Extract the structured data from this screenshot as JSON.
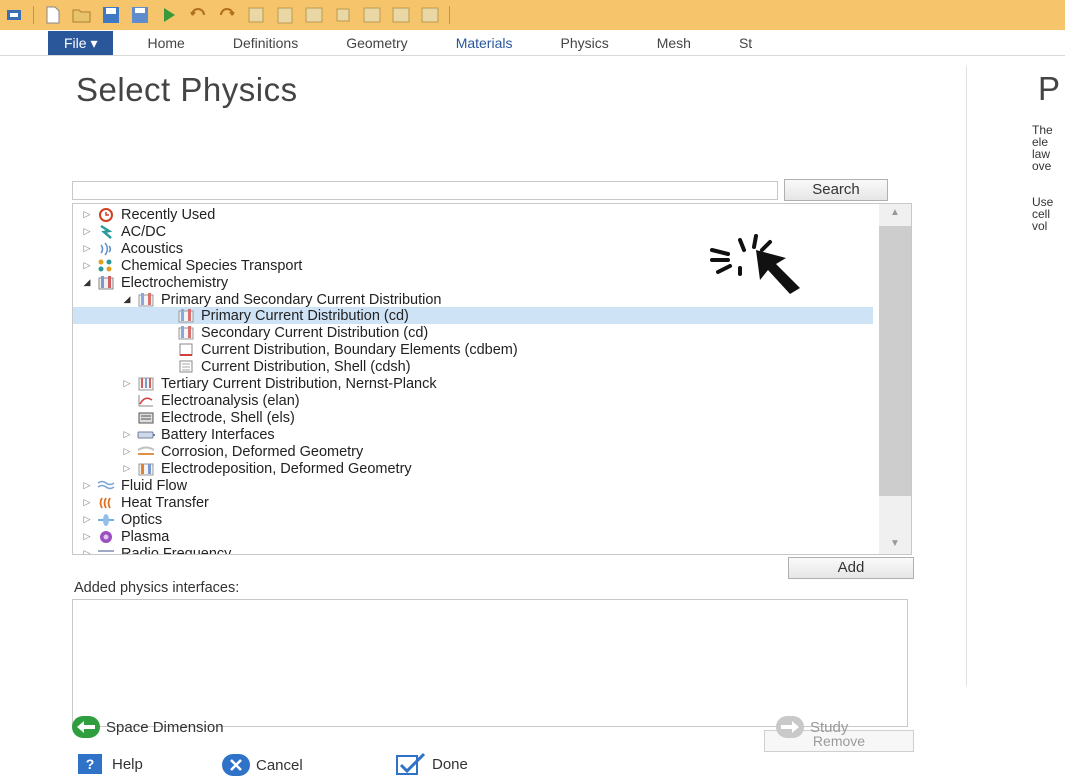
{
  "ribbon": {
    "tabs": [
      "File ▾",
      "Home",
      "Definitions",
      "Geometry",
      "Materials",
      "Physics",
      "Mesh",
      "St"
    ]
  },
  "panel": {
    "title": "Select Physics",
    "search": {
      "value": "",
      "button_label": "Search"
    },
    "tree": [
      {
        "label": "Recently Used",
        "level": 0,
        "expand": "collapsed",
        "icon": "clock-icon"
      },
      {
        "label": "AC/DC",
        "level": 0,
        "expand": "collapsed",
        "icon": "acdc-icon"
      },
      {
        "label": "Acoustics",
        "level": 0,
        "expand": "collapsed",
        "icon": "acoustics-icon"
      },
      {
        "label": "Chemical Species Transport",
        "level": 0,
        "expand": "collapsed",
        "icon": "species-icon"
      },
      {
        "label": "Electrochemistry",
        "level": 0,
        "expand": "expanded",
        "icon": "electrochemistry-icon"
      },
      {
        "label": "Primary and Secondary Current Distribution",
        "level": 1,
        "expand": "expanded",
        "icon": "current-distribution-icon"
      },
      {
        "label": "Primary Current Distribution (cd)",
        "level": 2,
        "expand": "none",
        "icon": "current-distribution-icon",
        "selected": true
      },
      {
        "label": "Secondary Current Distribution (cd)",
        "level": 2,
        "expand": "none",
        "icon": "current-distribution-icon"
      },
      {
        "label": "Current Distribution, Boundary Elements (cdbem)",
        "level": 2,
        "expand": "none",
        "icon": "boundary-elements-icon"
      },
      {
        "label": "Current Distribution, Shell (cdsh)",
        "level": 2,
        "expand": "none",
        "icon": "shell-icon"
      },
      {
        "label": "Tertiary Current Distribution, Nernst-Planck",
        "level": 1,
        "expand": "collapsed",
        "icon": "tertiary-icon"
      },
      {
        "label": "Electroanalysis (elan)",
        "level": 1,
        "expand": "none",
        "icon": "electroanalysis-icon"
      },
      {
        "label": "Electrode, Shell (els)",
        "level": 1,
        "expand": "none",
        "icon": "electrode-shell-icon"
      },
      {
        "label": "Battery Interfaces",
        "level": 1,
        "expand": "collapsed",
        "icon": "battery-icon"
      },
      {
        "label": "Corrosion, Deformed Geometry",
        "level": 1,
        "expand": "collapsed",
        "icon": "corrosion-icon"
      },
      {
        "label": "Electrodeposition, Deformed Geometry",
        "level": 1,
        "expand": "collapsed",
        "icon": "electrodeposition-icon"
      },
      {
        "label": "Fluid Flow",
        "level": 0,
        "expand": "collapsed",
        "icon": "fluid-flow-icon"
      },
      {
        "label": "Heat Transfer",
        "level": 0,
        "expand": "collapsed",
        "icon": "heat-transfer-icon"
      },
      {
        "label": "Optics",
        "level": 0,
        "expand": "collapsed",
        "icon": "optics-icon"
      },
      {
        "label": "Plasma",
        "level": 0,
        "expand": "collapsed",
        "icon": "plasma-icon"
      },
      {
        "label": "Radio Frequency",
        "level": 0,
        "expand": "collapsed",
        "icon": "radio-frequency-icon"
      }
    ],
    "add_label": "Add",
    "added_label": "Added physics interfaces:",
    "remove_label": "Remove",
    "space_dimension_label": "Space Dimension",
    "study_label": "Study",
    "help_label": "Help",
    "cancel_label": "Cancel",
    "done_label": "Done"
  },
  "right_panel": {
    "title": "P",
    "para1": [
      "The",
      "ele",
      "law",
      "ove"
    ],
    "para2": [
      "Use",
      "cell",
      "vol"
    ]
  },
  "colors": {
    "qat": "#f6c46a",
    "file_tab": "#2a579a",
    "selection": "#cfe3f7",
    "nav_green": "#2e9e3e",
    "cancel_blue": "#2f73c9"
  }
}
